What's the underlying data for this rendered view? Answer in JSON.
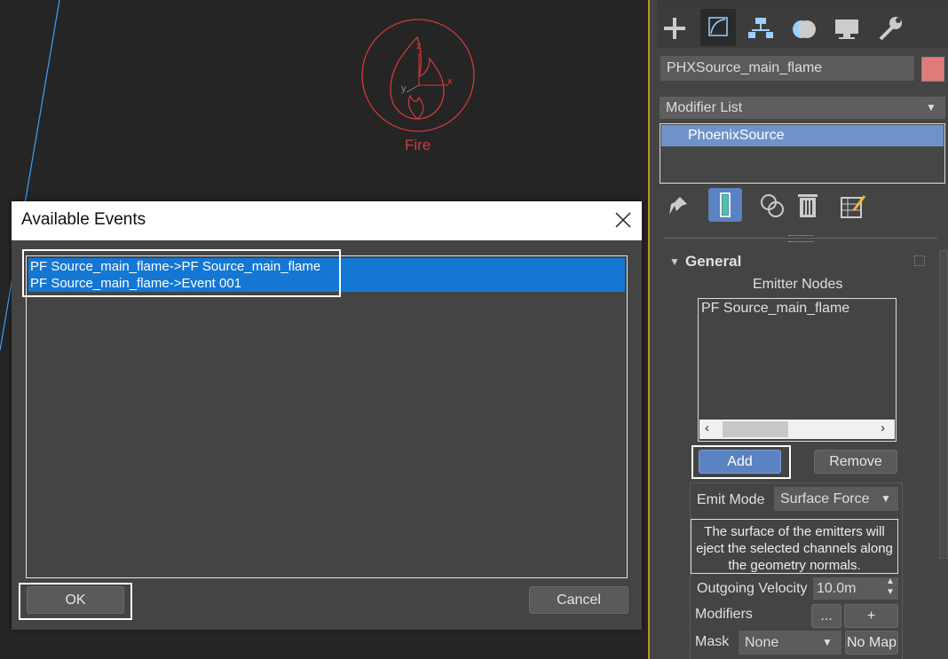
{
  "viewport": {
    "fire_label": "Fire",
    "axis_z": "z",
    "axis_x": "x",
    "axis_y": "y"
  },
  "dialog": {
    "title": "Available Events",
    "events": [
      "PF Source_main_flame->PF Source_main_flame",
      "PF Source_main_flame->Event 001"
    ],
    "ok_label": "OK",
    "cancel_label": "Cancel"
  },
  "panel": {
    "tabs": [
      "plus-icon",
      "modify-icon",
      "hierarchy-icon",
      "motion-icon",
      "display-icon",
      "utilities-icon"
    ],
    "object_name": "PHXSource_main_flame",
    "object_color": "#e07b7b",
    "modifier_list_label": "Modifier List",
    "modifier_stack": [
      "PhoenixSource"
    ],
    "general": {
      "title": "General",
      "emitter_nodes_label": "Emitter Nodes",
      "emitter_nodes": [
        "PF Source_main_flame"
      ],
      "add_label": "Add",
      "remove_label": "Remove",
      "emit_mode_label": "Emit Mode",
      "emit_mode_value": "Surface Force",
      "description": "The surface of the emitters will eject the selected channels along the geometry normals.",
      "outgoing_velocity_label": "Outgoing Velocity",
      "outgoing_velocity_value": "10.0m",
      "modifiers_label": "Modifiers",
      "modifiers_btn1": "...",
      "modifiers_btn2": "+",
      "mask_label": "Mask",
      "mask_value": "None",
      "no_map_label": "No Map"
    }
  }
}
